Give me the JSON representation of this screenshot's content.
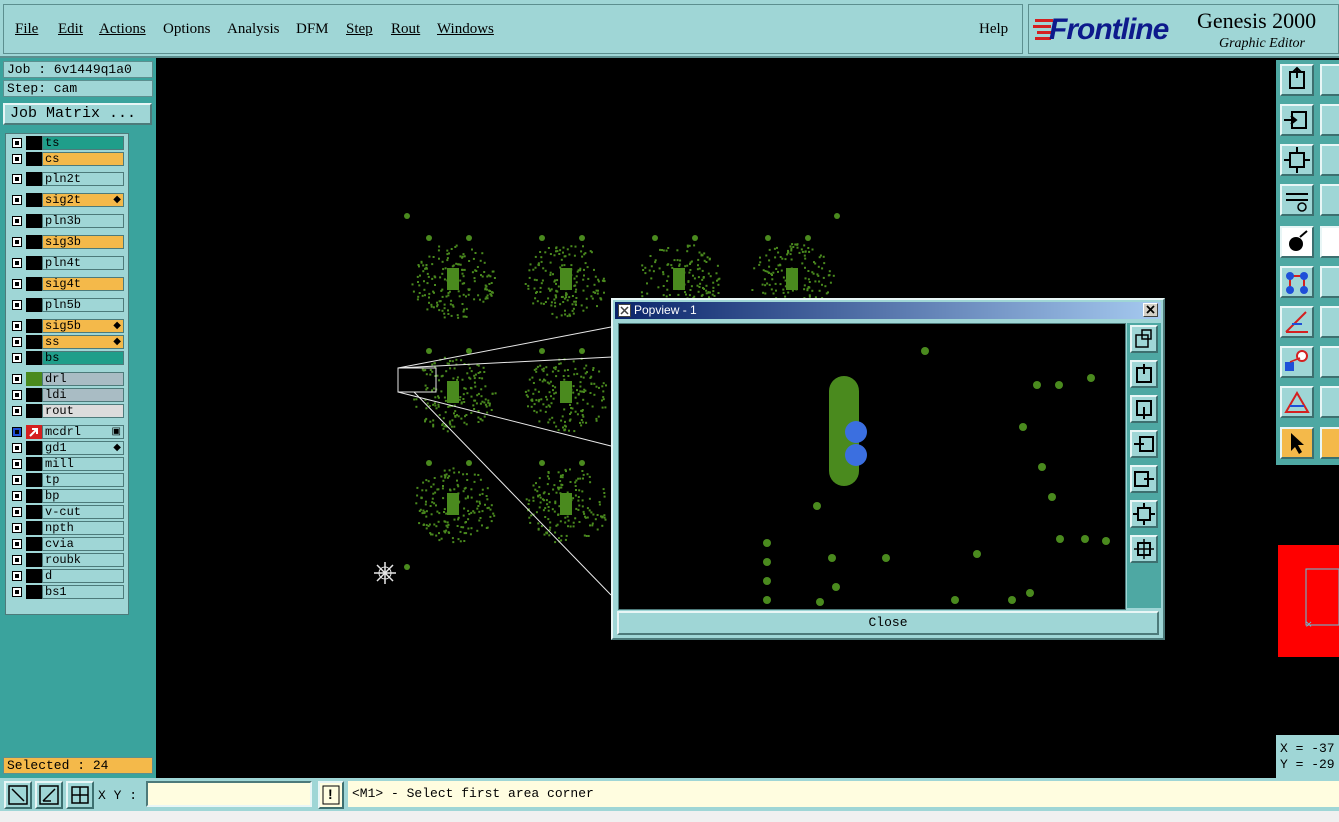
{
  "menubar": {
    "items": [
      {
        "label": "File"
      },
      {
        "label": "Edit"
      },
      {
        "label": "Actions"
      },
      {
        "label": "Options"
      },
      {
        "label": "Analysis"
      },
      {
        "label": "DFM"
      },
      {
        "label": "Step"
      },
      {
        "label": "Rout"
      },
      {
        "label": "Windows"
      }
    ],
    "help": "Help"
  },
  "brand": {
    "logo": "Frontline",
    "product": "Genesis 2000",
    "subtitle": "Graphic Editor"
  },
  "job": {
    "job_line": "Job : 6v1449q1a0",
    "step_line": "Step: cam",
    "matrix_button": "Job Matrix ..."
  },
  "layers": [
    {
      "name": "ts",
      "color": "#1f9e8a",
      "mark": ""
    },
    {
      "name": "cs",
      "color": "#f4b94a",
      "mark": ""
    },
    {
      "name": "pln2t",
      "color": "#9fd6d6",
      "mark": ""
    },
    {
      "name": "sig2t",
      "color": "#f4b94a",
      "mark": "◆"
    },
    {
      "name": "pln3b",
      "color": "#9fd6d6",
      "mark": ""
    },
    {
      "name": "sig3b",
      "color": "#f4b94a",
      "mark": ""
    },
    {
      "name": "pln4t",
      "color": "#9fd6d6",
      "mark": ""
    },
    {
      "name": "sig4t",
      "color": "#f4b94a",
      "mark": ""
    },
    {
      "name": "pln5b",
      "color": "#9fd6d6",
      "mark": ""
    },
    {
      "name": "sig5b",
      "color": "#f4b94a",
      "mark": "◆"
    },
    {
      "name": "ss",
      "color": "#f4b94a",
      "mark": "◆"
    },
    {
      "name": "bs",
      "color": "#1f9e8a",
      "mark": ""
    },
    {
      "name": "drl",
      "color": "#a9bcc4",
      "mark": ""
    },
    {
      "name": "ldi",
      "color": "#a9bcc4",
      "mark": ""
    },
    {
      "name": "rout",
      "color": "#dcdcdc",
      "mark": ""
    },
    {
      "name": "mcdrl",
      "color": "#9fd6d6",
      "mark": "▣"
    },
    {
      "name": "gd1",
      "color": "#9fd6d6",
      "mark": "◆"
    },
    {
      "name": "mill",
      "color": "#9fd6d6",
      "mark": ""
    },
    {
      "name": "tp",
      "color": "#9fd6d6",
      "mark": ""
    },
    {
      "name": "bp",
      "color": "#9fd6d6",
      "mark": ""
    },
    {
      "name": "v-cut",
      "color": "#9fd6d6",
      "mark": ""
    },
    {
      "name": "npth",
      "color": "#9fd6d6",
      "mark": ""
    },
    {
      "name": "cvia",
      "color": "#9fd6d6",
      "mark": ""
    },
    {
      "name": "roubk",
      "color": "#9fd6d6",
      "mark": ""
    },
    {
      "name": "d",
      "color": "#9fd6d6",
      "mark": ""
    },
    {
      "name": "bs1",
      "color": "#9fd6d6",
      "mark": ""
    }
  ],
  "selected": "Selected : 24",
  "popview": {
    "title": "Popview - 1",
    "close_label": "Close"
  },
  "coords": {
    "x": "X = -37",
    "y": "Y = -29"
  },
  "statusbar": {
    "xy_label": "X Y :",
    "xy_value": "",
    "alert_icon": "!",
    "prompt": "<M1> - Select first area corner"
  },
  "colors": {
    "panel": "#9fd6d6",
    "panel_dark": "#3aa39d",
    "board_green": "#4a8a1e",
    "pad_blue": "#3b6fe0",
    "accent_orange": "#f4b94a",
    "overview_red": "#ff0000"
  }
}
